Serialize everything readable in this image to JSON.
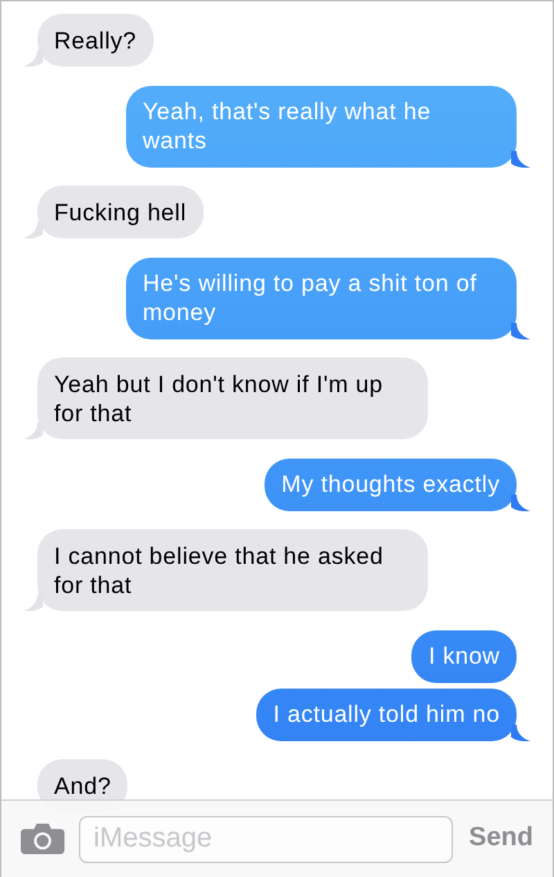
{
  "messages": [
    {
      "kind": "received",
      "text": "Really?",
      "tail": true
    },
    {
      "kind": "sent",
      "text": "Yeah, that's really what he wants",
      "tail": true
    },
    {
      "kind": "received",
      "text": "Fucking hell",
      "tail": true
    },
    {
      "kind": "sent",
      "text": "He's willing to pay a shit ton of money",
      "tail": true
    },
    {
      "kind": "received",
      "text": "Yeah but I don't know if I'm up for that",
      "tail": true
    },
    {
      "kind": "sent",
      "text": "My thoughts exactly",
      "tail": true
    },
    {
      "kind": "received",
      "text": "I cannot believe that he asked for that",
      "tail": true
    },
    {
      "kind": "sent",
      "text": "I know",
      "tail": false
    },
    {
      "kind": "sent",
      "text": "I actually told him no",
      "tail": true
    },
    {
      "kind": "received",
      "text": "And?",
      "tail": false
    }
  ],
  "composer": {
    "placeholder": "iMessage",
    "send": "Send"
  }
}
